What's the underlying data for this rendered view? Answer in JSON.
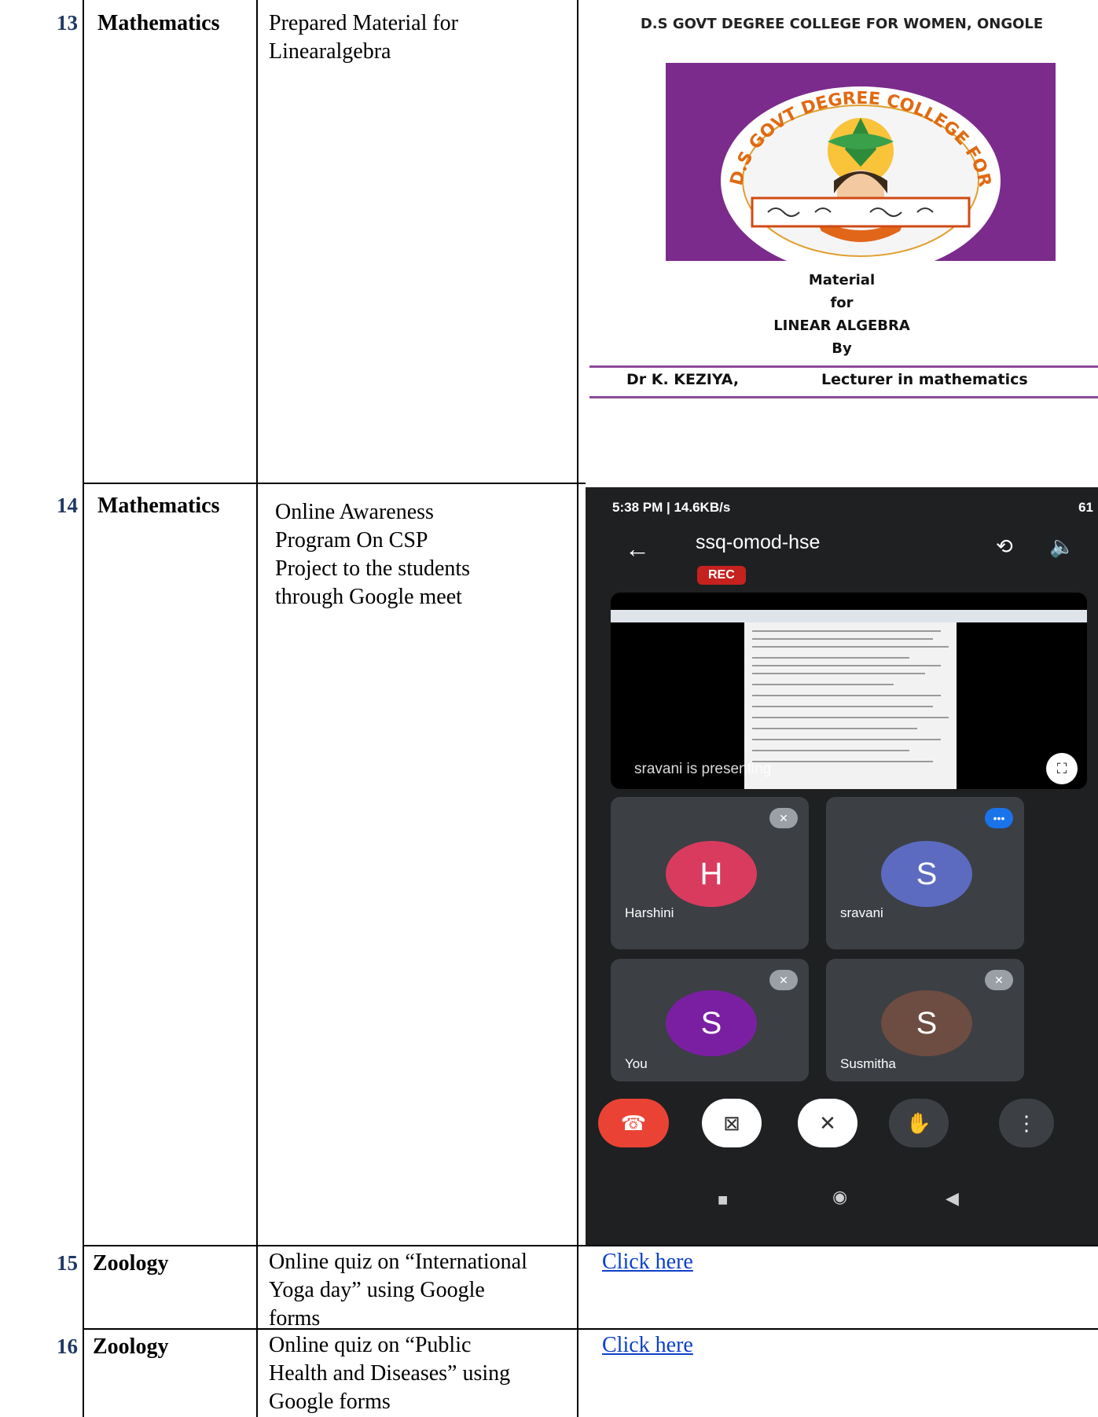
{
  "rows": [
    {
      "num": "13",
      "subject": "Mathematics",
      "description": [
        "Prepared Material for",
        "Linearalgebra"
      ]
    },
    {
      "num": "14",
      "subject": "Mathematics",
      "description": [
        "Online Awareness",
        "Program On CSP",
        "Project to the students",
        "through Google meet"
      ]
    },
    {
      "num": "15",
      "subject": "Zoology",
      "description": [
        "Online quiz on “International",
        "Yoga day” using Google",
        "forms"
      ],
      "link": "Click here"
    },
    {
      "num": "16",
      "subject": "Zoology",
      "description": [
        "Online quiz on “Public",
        "Health and Diseases” using",
        "Google forms"
      ],
      "link": "Click here"
    }
  ],
  "cover": {
    "college": "D.S GOVT DEGREE COLLEGE FOR WOMEN, ONGOLE",
    "logo_ring": "D.S GOVT DEGREE COLLEGE FOR WOMEN ONGOLE",
    "lines": [
      "Material",
      "for",
      "LINEAR ALGEBRA",
      "By"
    ],
    "author": "Dr K. KEZIYA,",
    "role": "Lecturer in mathematics"
  },
  "meet": {
    "status_left": "5:38 PM | 14.6KB/s",
    "status_right": "61",
    "title": "ssq-omod-hse",
    "rec": "REC",
    "presenting": "sravani is presenting",
    "participants": [
      {
        "initial": "H",
        "name": "Harshini",
        "color": "#d93b5e"
      },
      {
        "initial": "S",
        "name": "sravani",
        "color": "#5c6bc0"
      },
      {
        "initial": "S",
        "name": "You",
        "color": "#7b1fa2"
      },
      {
        "initial": "S",
        "name": "Susmitha",
        "color": "#6d4c41"
      }
    ]
  }
}
